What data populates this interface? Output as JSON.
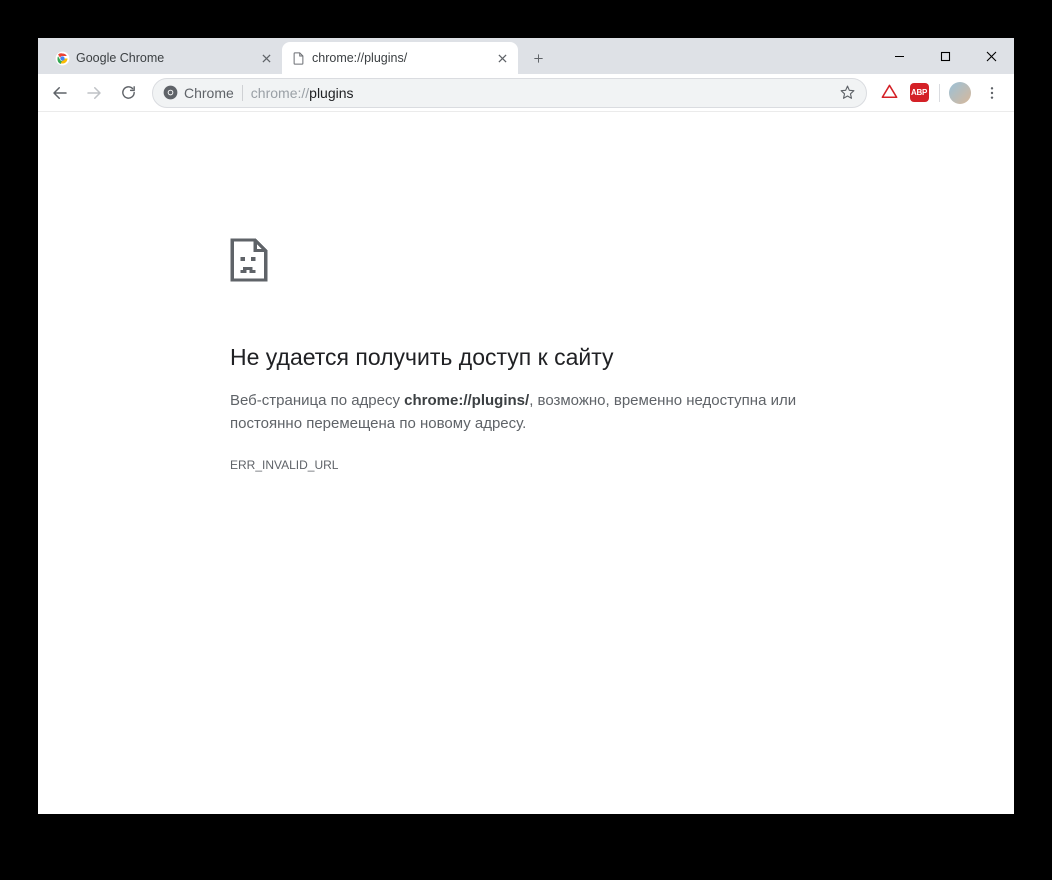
{
  "tabs": [
    {
      "title": "Google Chrome",
      "active": false
    },
    {
      "title": "chrome://plugins/",
      "active": true
    }
  ],
  "toolbar": {
    "chip_label": "Chrome",
    "url_dim": "chrome://",
    "url_bold": "plugins"
  },
  "error": {
    "title": "Не удается получить доступ к сайту",
    "body_pre": "Веб-страница по адресу ",
    "body_bold": "chrome://plugins/",
    "body_post": ", возможно, временно недоступна или постоянно перемещена по новому адресу.",
    "code": "ERR_INVALID_URL"
  },
  "icons": {
    "abp": "ABP"
  }
}
